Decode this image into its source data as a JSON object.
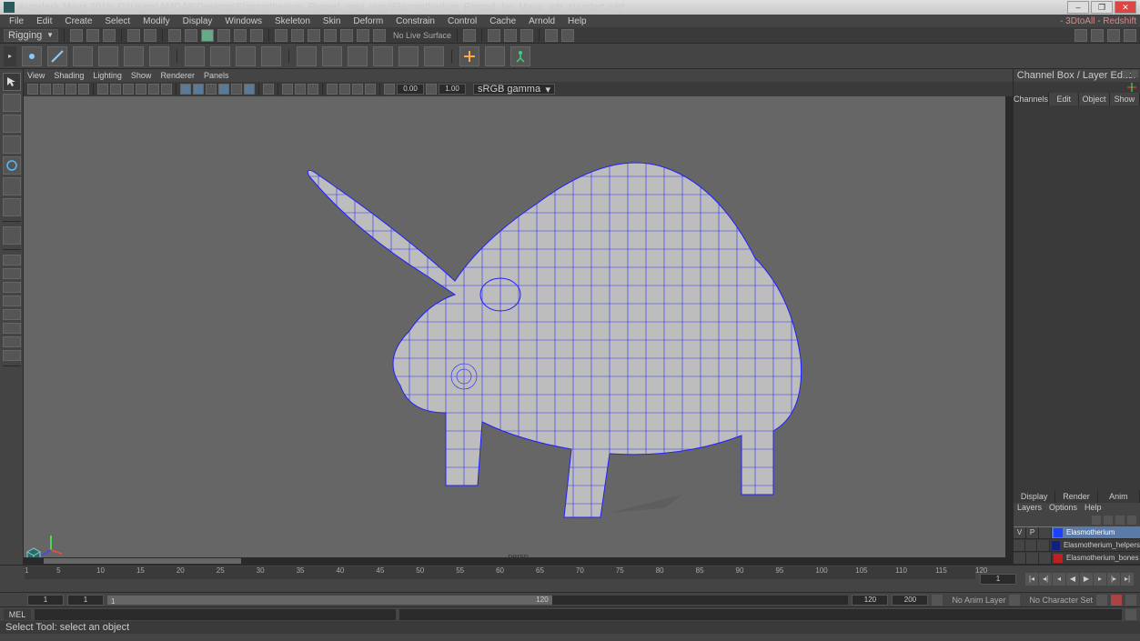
{
  "titlebar": {
    "app": "Autodesk Maya 2016:",
    "path": "C:\\Users\\AMDA8\\Desktop\\Elasmotherium_Rigged_max_vray\\Elasmotherium_Rigged_for_Maya_mb_standart.mb*"
  },
  "menubar": {
    "items": [
      "File",
      "Edit",
      "Create",
      "Select",
      "Modify",
      "Display",
      "Windows",
      "Skeleton",
      "Skin",
      "Deform",
      "Constrain",
      "Control",
      "Cache",
      "Arnold",
      "Help"
    ],
    "right": "- 3DtoAll -   Redshift"
  },
  "module": {
    "label": "Rigging",
    "nolive": "No Live Surface"
  },
  "panelmenu": {
    "items": [
      "View",
      "Shading",
      "Lighting",
      "Show",
      "Renderer",
      "Panels"
    ]
  },
  "paneltools": {
    "field1": "0.00",
    "field2": "1.00",
    "gamma": "sRGB gamma"
  },
  "viewport": {
    "camera": "persp"
  },
  "channelbox": {
    "title": "Channel Box / Layer Editor",
    "tabs": [
      "Channels",
      "Edit",
      "Object",
      "Show"
    ]
  },
  "layereditor": {
    "tabs": [
      "Display",
      "Render",
      "Anim"
    ],
    "menu": [
      "Layers",
      "Options",
      "Help"
    ],
    "layers": [
      {
        "v": "V",
        "p": "P",
        "r": "",
        "color": "#2040ff",
        "name": "Elasmotherium",
        "sel": true
      },
      {
        "v": "",
        "p": "",
        "r": "",
        "color": "#102080",
        "name": "Elasmotherium_helpers",
        "sel": false
      },
      {
        "v": "",
        "p": "",
        "r": "",
        "color": "#c02020",
        "name": "Elasmotherium_bones",
        "sel": false
      }
    ]
  },
  "timeline": {
    "ticks": [
      1,
      5,
      10,
      15,
      20,
      25,
      30,
      35,
      40,
      45,
      50,
      55,
      60,
      65,
      70,
      75,
      80,
      85,
      90,
      95,
      100,
      105,
      110,
      115,
      120
    ],
    "start": "1",
    "end": "120",
    "rangeStart": "1",
    "rangeEnd": "120",
    "min": "1",
    "max": "200",
    "animLayer": "No Anim Layer",
    "charSet": "No Character Set"
  },
  "cmd": {
    "label": "MEL"
  },
  "help": {
    "text": "Select Tool: select an object"
  }
}
